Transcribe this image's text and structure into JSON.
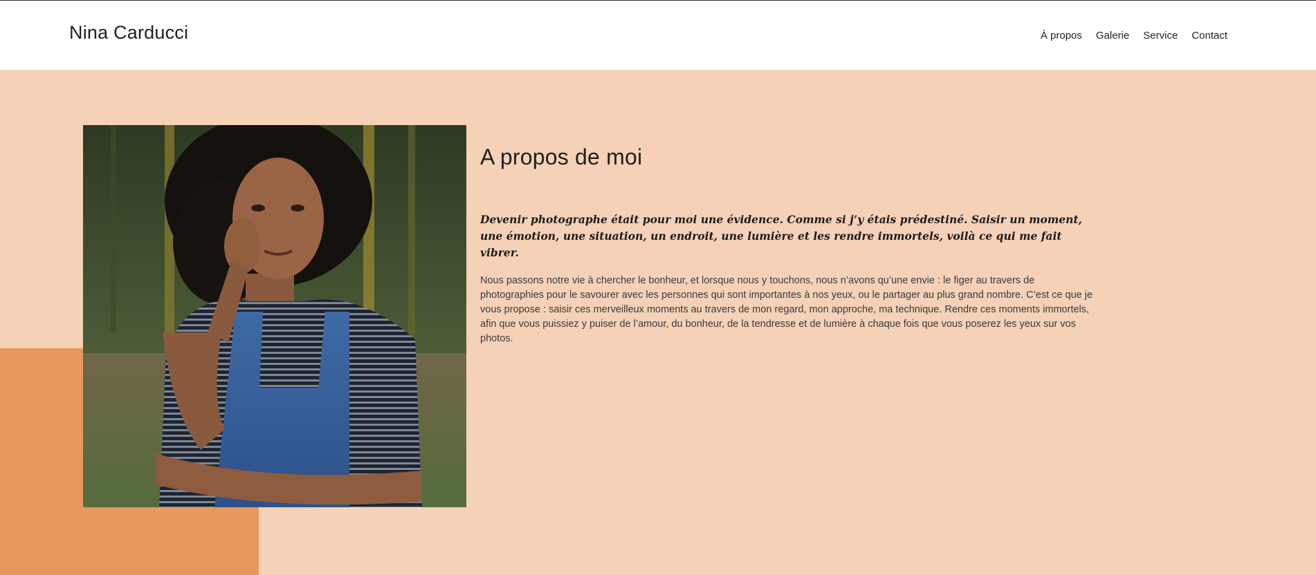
{
  "header": {
    "logo": "Nina Carducci",
    "nav": [
      {
        "label": "À propos"
      },
      {
        "label": "Galerie"
      },
      {
        "label": "Service"
      },
      {
        "label": "Contact"
      }
    ]
  },
  "about": {
    "title": "A propos de moi",
    "lead": "Devenir photographe était pour moi une évidence. Comme si j’y étais prédestiné. Saisir un moment, une émotion, une situation, un endroit, une lumière et les rendre immortels, voilà ce qui me fait vibrer.",
    "body": "Nous passons notre vie à chercher le bonheur, et lorsque nous y touchons, nous n’avons qu’une envie : le figer au travers de photographies pour le savourer avec les personnes qui sont importantes à nos yeux, ou le partager au plus grand nombre. C’est ce que je vous propose : saisir ces merveilleux moments au travers de mon regard, mon approche, ma technique. Rendre ces moments immortels, afin que vous puissiez y puiser de l’amour, du bonheur, de la tendresse et de lumière à chaque fois que vous poserez les yeux sur vos photos."
  },
  "colors": {
    "section_background": "#f5d1b7",
    "accent_block": "#e8975f",
    "header_background": "#ffffff"
  }
}
